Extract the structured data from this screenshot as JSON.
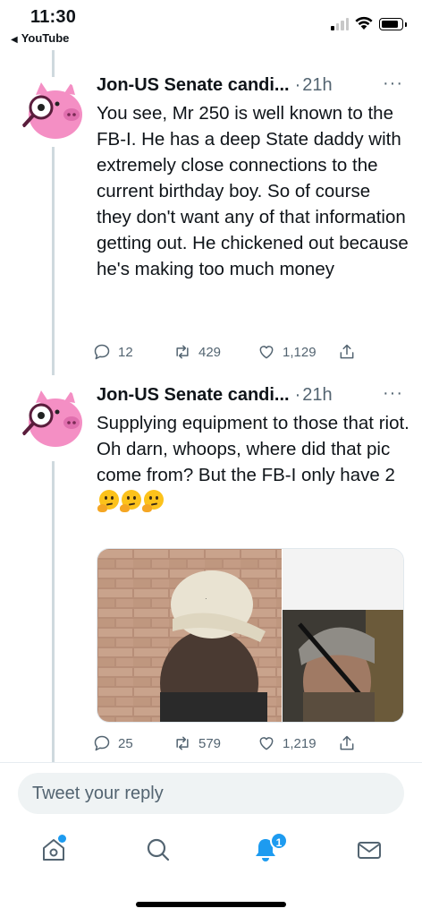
{
  "status_bar": {
    "time": "11:30",
    "back_app": "YouTube"
  },
  "tweets": [
    {
      "author": "Jon-US Senate candi...",
      "time": "21h",
      "text": "You see, Mr 250 is well known to the FB-I. He has a deep State daddy with extremely close connections to the current birthday boy. So of course they don't want any of that information getting out. He chickened out because he's making too much money",
      "replies": "12",
      "retweets": "429",
      "likes": "1,129"
    },
    {
      "author": "Jon-US Senate candi...",
      "time": "21h",
      "text_line1": "Supplying equipment to those that riot.",
      "text_line2": "Oh darn, whoops, where did that pic come from? But the FB-I only have 2",
      "emoji": "thinking-face",
      "replies": "25",
      "retweets": "579",
      "likes": "1,219"
    }
  ],
  "reply_box": {
    "placeholder": "Tweet your reply"
  },
  "tab_bar": {
    "notifications_badge": "1",
    "items": [
      "home-icon",
      "search-icon",
      "notifications-icon",
      "messages-icon"
    ]
  },
  "colors": {
    "accent": "#1d9bf0",
    "secondary_text": "#536471",
    "avatar_pig": "#f48fc4"
  }
}
